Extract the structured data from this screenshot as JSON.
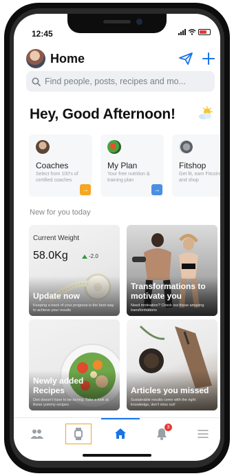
{
  "status_bar": {
    "time": "12:45"
  },
  "header": {
    "title": "Home"
  },
  "search": {
    "placeholder": "Find people, posts, recipes and mo..."
  },
  "greeting": "Hey, Good Afternoon!",
  "quick_actions": [
    {
      "label": "Coaches",
      "description": "Select from 100's of certified coaches",
      "arrow_color": "#f5a623"
    },
    {
      "label": "My Plan",
      "description": "Your free nutrition & training plan",
      "arrow_color": "#4a90e2"
    },
    {
      "label": "Fitshop",
      "description": "Get fit, earn Fitcoins and shop",
      "arrow_color": "#4a90e2"
    }
  ],
  "section_title": "New for you today",
  "feed": {
    "weight": {
      "label": "Current Weight",
      "value": "58.0Kg",
      "delta": "-2.0",
      "title": "Update now",
      "description": "Keeping a track of your progress is the best way to achieve your results"
    },
    "transformations": {
      "title": "Transformations to motivate you",
      "description": "Need motivation? Check out these amazing transformations"
    },
    "recipes": {
      "title": "Newly added Recipes",
      "description": "Diet doesn't have to be boring. Take a look at these yummy recipes"
    },
    "articles": {
      "title": "Articles you missed",
      "description": "Sustainable results come with the right knowledge, don't miss out!"
    }
  },
  "tabbar": {
    "items": [
      "people-icon",
      "watch-icon",
      "home-icon",
      "bell-icon",
      "menu-icon"
    ],
    "active": "home-icon",
    "notification_count": "3"
  },
  "colors": {
    "accent": "#1a73e8",
    "badge": "#e53935",
    "positive": "#2e9c3f"
  }
}
